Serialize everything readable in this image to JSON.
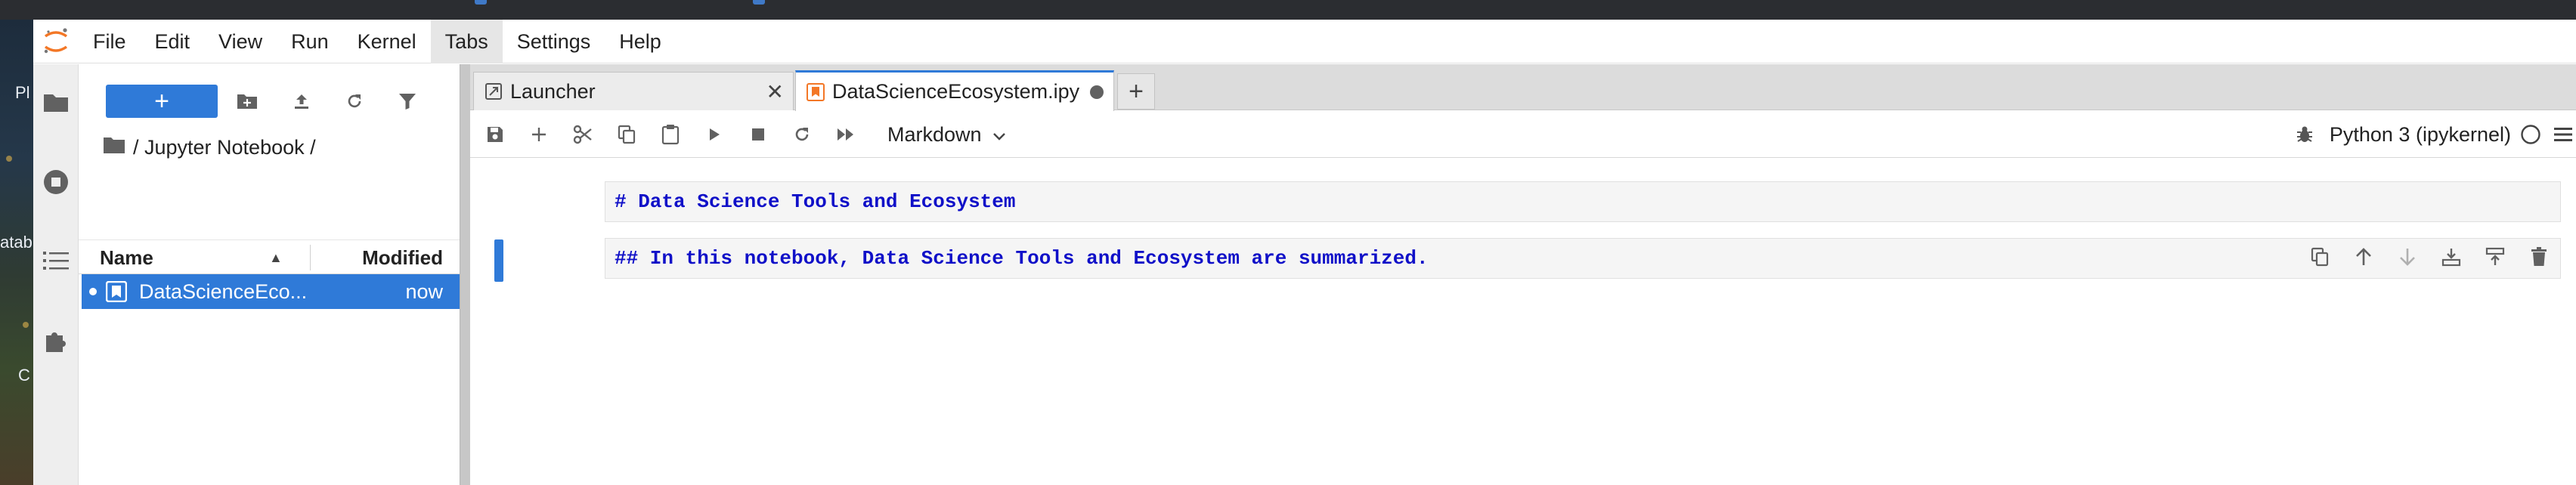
{
  "menubar": {
    "items": [
      "File",
      "Edit",
      "View",
      "Run",
      "Kernel",
      "Tabs",
      "Settings",
      "Help"
    ],
    "active_index": 5
  },
  "file_browser": {
    "new_button_label": "+",
    "breadcrumb": "/ Jupyter Notebook /",
    "columns": {
      "name": "Name",
      "modified": "Modified"
    },
    "files": [
      {
        "name": "DataScienceEco...",
        "modified": "now",
        "running": true,
        "selected": true
      }
    ]
  },
  "tabs": [
    {
      "label": "Launcher",
      "icon": "launcher-icon",
      "active": false,
      "close": "✕"
    },
    {
      "label": "DataScienceEcosystem.ipy",
      "icon": "notebook-icon",
      "active": true,
      "unsaved": true
    }
  ],
  "add_tab_label": "+",
  "notebook_toolbar": {
    "cell_type": "Markdown",
    "kernel_name": "Python 3 (ipykernel)"
  },
  "cells": [
    {
      "text": "# Data Science Tools and Ecosystem",
      "active": false
    },
    {
      "text": "## In this notebook, Data Science Tools and Ecosystem are summarized.",
      "active": true
    }
  ],
  "colors": {
    "accent": "#2f7ad8",
    "markdown_text": "#1010c8",
    "jupyter_orange": "#f37726"
  }
}
